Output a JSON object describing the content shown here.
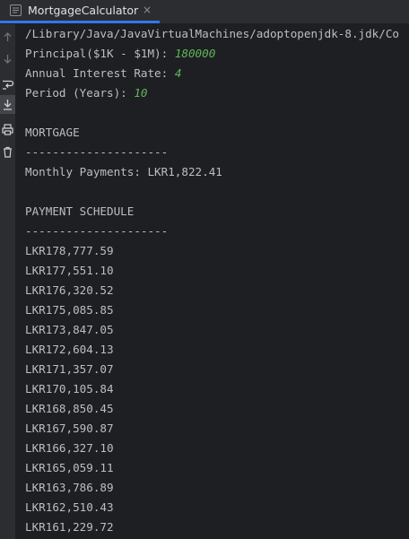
{
  "tab": {
    "title": "MortgageCalculator",
    "close": "×"
  },
  "console": {
    "command": "/Library/Java/JavaVirtualMachines/adoptopenjdk-8.jdk/Co",
    "principal_prompt": "Principal($1K - $1M): ",
    "principal_input": "180000",
    "rate_prompt": "Annual Interest Rate: ",
    "rate_input": "4",
    "period_prompt": "Period (Years): ",
    "period_input": "10",
    "mortgage_header": "MORTGAGE",
    "mortgage_divider": "---------------------",
    "monthly_payments": "Monthly Payments: LKR1,822.41",
    "schedule_header": "PAYMENT SCHEDULE",
    "schedule_divider": "---------------------",
    "schedule": [
      "LKR178,777.59",
      "LKR177,551.10",
      "LKR176,320.52",
      "LKR175,085.85",
      "LKR173,847.05",
      "LKR172,604.13",
      "LKR171,357.07",
      "LKR170,105.84",
      "LKR168,850.45",
      "LKR167,590.87",
      "LKR166,327.10",
      "LKR165,059.11",
      "LKR163,786.89",
      "LKR162,510.43",
      "LKR161,229.72"
    ]
  },
  "gutter_icons": [
    "arrow-up-icon",
    "arrow-down-icon",
    "soft-wrap-icon",
    "scroll-to-end-icon",
    "print-icon",
    "trash-icon"
  ],
  "colors": {
    "input": "#5fb85a",
    "text": "#bcbec4",
    "background": "#1e1f22",
    "tab_accent": "#3574f0"
  }
}
